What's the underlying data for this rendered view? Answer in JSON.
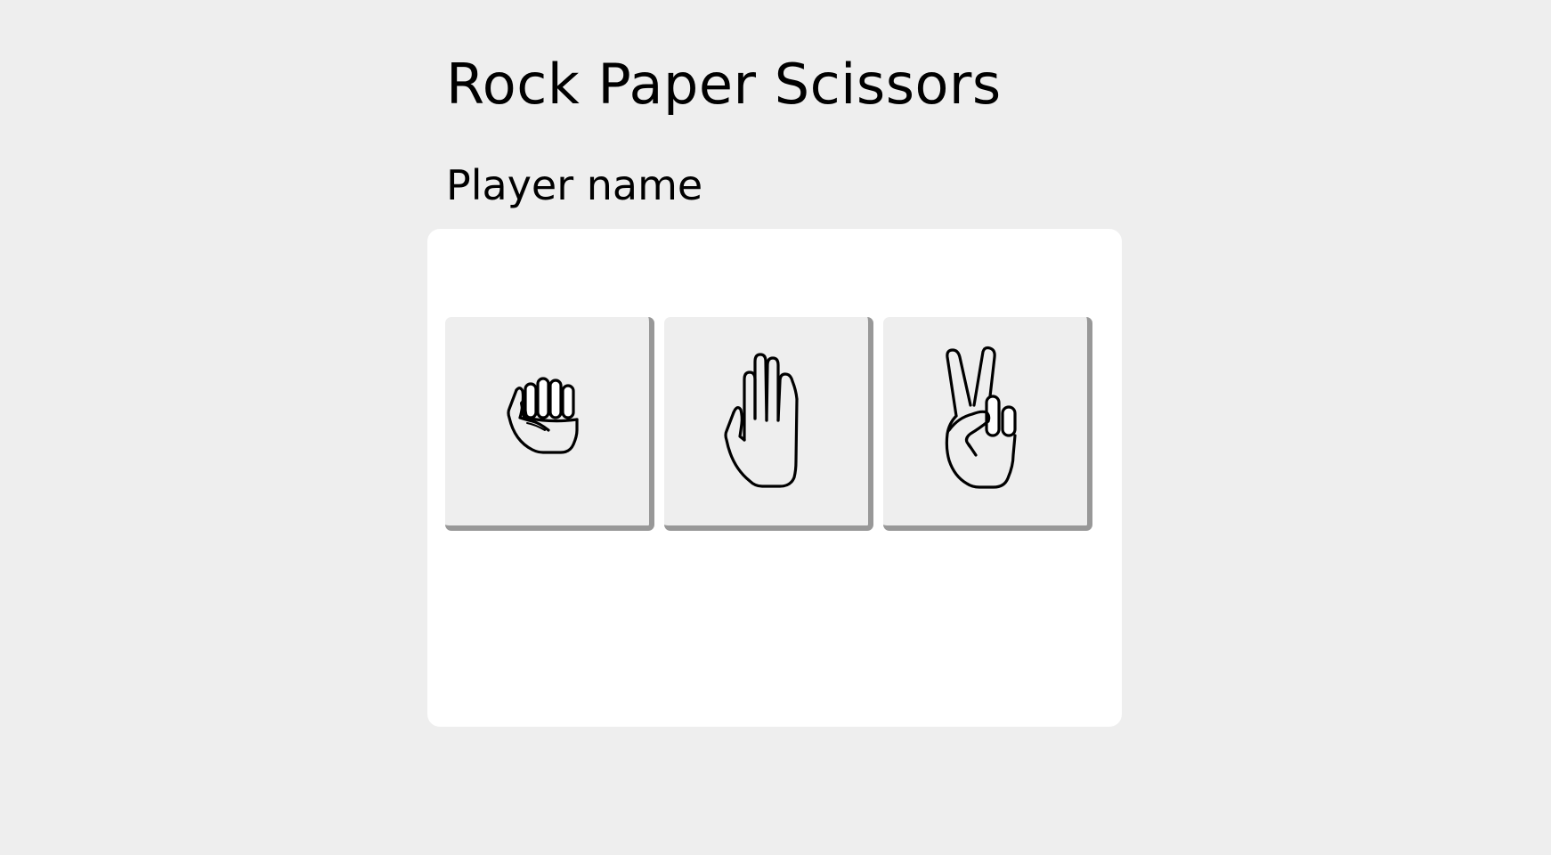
{
  "game": {
    "title": "Rock Paper Scissors",
    "player_label": "Player name"
  },
  "choices": [
    {
      "id": "rock",
      "icon": "fist-hand-icon"
    },
    {
      "id": "paper",
      "icon": "open-hand-icon"
    },
    {
      "id": "scissors",
      "icon": "peace-hand-icon"
    }
  ],
  "colors": {
    "background": "#eeeeee",
    "card": "#ffffff",
    "button": "#eeeeee",
    "button_shadow": "#989898",
    "ink": "#000000"
  }
}
